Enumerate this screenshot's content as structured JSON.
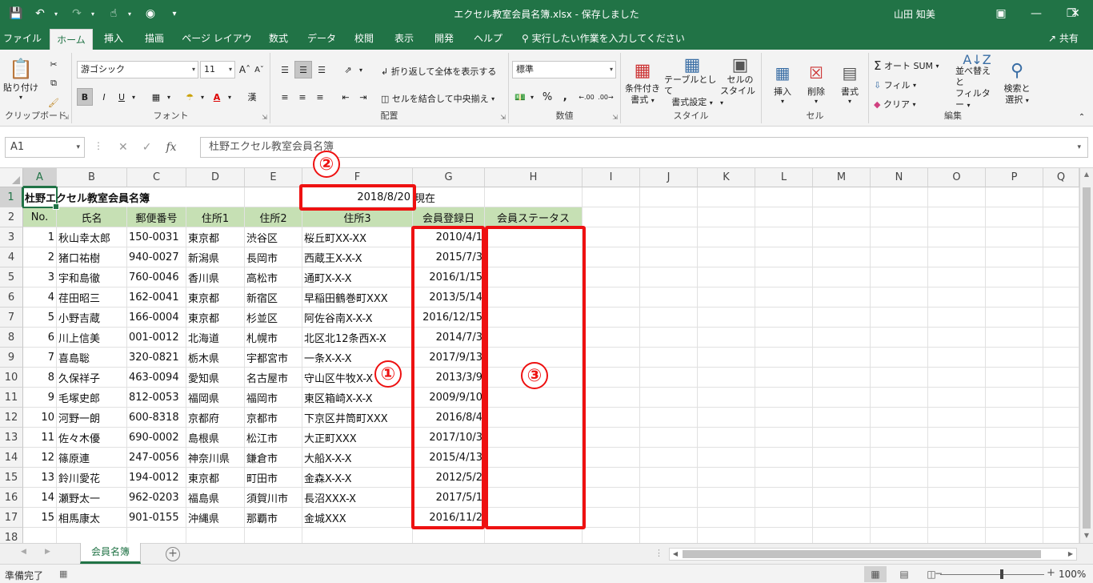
{
  "window": {
    "title": "エクセル教室会員名簿.xlsx  -  保存しました",
    "user": "山田 知美"
  },
  "qat": {
    "icons": [
      "save-icon",
      "undo-icon",
      "redo-icon",
      "touch-mode-icon",
      "camera-icon",
      "customize-icon"
    ]
  },
  "ribbon_tabs": [
    "ファイル",
    "ホーム",
    "挿入",
    "描画",
    "ページ レイアウト",
    "数式",
    "データ",
    "校閲",
    "表示",
    "開発",
    "ヘルプ"
  ],
  "tell_me": "実行したい作業を入力してください",
  "share": "共有",
  "clipboard": {
    "paste": "貼り付け",
    "label": "クリップボード"
  },
  "font": {
    "name": "游ゴシック",
    "size": "11",
    "label": "フォント",
    "bold": "B",
    "italic": "I",
    "underline": "U"
  },
  "alignment": {
    "wrap": "折り返して全体を表示する",
    "merge": "セルを結合して中央揃え",
    "label": "配置"
  },
  "number": {
    "format": "標準",
    "label": "数値",
    "percent": "%"
  },
  "styles": {
    "conditional": [
      "条件付き",
      "書式"
    ],
    "table": [
      "テーブルとして",
      "書式設定"
    ],
    "cell": [
      "セルの",
      "スタイル"
    ],
    "label": "スタイル"
  },
  "cells": {
    "insert": "挿入",
    "delete": "削除",
    "format": "書式",
    "label": "セル"
  },
  "editing": {
    "autosum": "オート SUM",
    "fill": "フィル",
    "clear": "クリア",
    "sort": [
      "並べ替えと",
      "フィルター"
    ],
    "find": [
      "検索と",
      "選択"
    ],
    "label": "編集"
  },
  "formula_bar": {
    "name_box": "A1",
    "fx": "fx",
    "content": "杜野エクセル教室会員名簿"
  },
  "columns": [
    "A",
    "B",
    "C",
    "D",
    "E",
    "F",
    "G",
    "H",
    "I",
    "J",
    "K",
    "L",
    "M",
    "N",
    "O",
    "P",
    "Q"
  ],
  "rows": [
    "1",
    "2",
    "3",
    "4",
    "5",
    "6",
    "7",
    "8",
    "9",
    "10",
    "11",
    "12",
    "13",
    "14",
    "15",
    "16",
    "17",
    "18"
  ],
  "sheet": {
    "title": "杜野エクセル教室会員名簿",
    "as_of_date": "2018/8/20",
    "as_of_suffix": "現在",
    "headers": [
      "No.",
      "氏名",
      "郵便番号",
      "住所1",
      "住所2",
      "住所3",
      "会員登録日",
      "会員ステータス"
    ],
    "members": [
      [
        "1",
        "秋山幸太郎",
        "150-0031",
        "東京都",
        "渋谷区",
        "桜丘町XX-XX",
        "2010/4/1"
      ],
      [
        "2",
        "猪口祐樹",
        "940-0027",
        "新潟県",
        "長岡市",
        "西蔵王X-X-X",
        "2015/7/3"
      ],
      [
        "3",
        "宇和島徹",
        "760-0046",
        "香川県",
        "高松市",
        "通町X-X-X",
        "2016/1/15"
      ],
      [
        "4",
        "荏田昭三",
        "162-0041",
        "東京都",
        "新宿区",
        "早稲田鶴巻町XXX",
        "2013/5/14"
      ],
      [
        "5",
        "小野吉蔵",
        "166-0004",
        "東京都",
        "杉並区",
        "阿佐谷南X-X-X",
        "2016/12/15"
      ],
      [
        "6",
        "川上信美",
        "001-0012",
        "北海道",
        "札幌市",
        "北区北12条西X-X",
        "2014/7/3"
      ],
      [
        "7",
        "喜島聡",
        "320-0821",
        "栃木県",
        "宇都宮市",
        "一条X-X-X",
        "2017/9/13"
      ],
      [
        "8",
        "久保祥子",
        "463-0094",
        "愛知県",
        "名古屋市",
        "守山区牛牧X-X",
        "2013/3/9"
      ],
      [
        "9",
        "毛塚史郎",
        "812-0053",
        "福岡県",
        "福岡市",
        "東区箱崎X-X-X",
        "2009/9/10"
      ],
      [
        "10",
        "河野一朗",
        "600-8318",
        "京都府",
        "京都市",
        "下京区井筒町XXX",
        "2016/8/4"
      ],
      [
        "11",
        "佐々木優",
        "690-0002",
        "島根県",
        "松江市",
        "大正町XXX",
        "2017/10/3"
      ],
      [
        "12",
        "篠原連",
        "247-0056",
        "神奈川県",
        "鎌倉市",
        "大船X-X-X",
        "2015/4/13"
      ],
      [
        "13",
        "鈴川愛花",
        "194-0012",
        "東京都",
        "町田市",
        "金森X-X-X",
        "2012/5/2"
      ],
      [
        "14",
        "瀬野太一",
        "962-0203",
        "福島県",
        "須賀川市",
        "長沼XXX-X",
        "2017/5/1"
      ],
      [
        "15",
        "相馬康太",
        "901-0155",
        "沖縄県",
        "那覇市",
        "金城XXX",
        "2016/11/2"
      ]
    ]
  },
  "annotations": [
    "①",
    "②",
    "③"
  ],
  "annotation_color": "#ee1111",
  "sheet_tab": "会員名簿",
  "status": {
    "ready": "準備完了",
    "zoom": "100%"
  },
  "colors": {
    "brand": "#217346",
    "header_fill": "#c6e0b4"
  }
}
